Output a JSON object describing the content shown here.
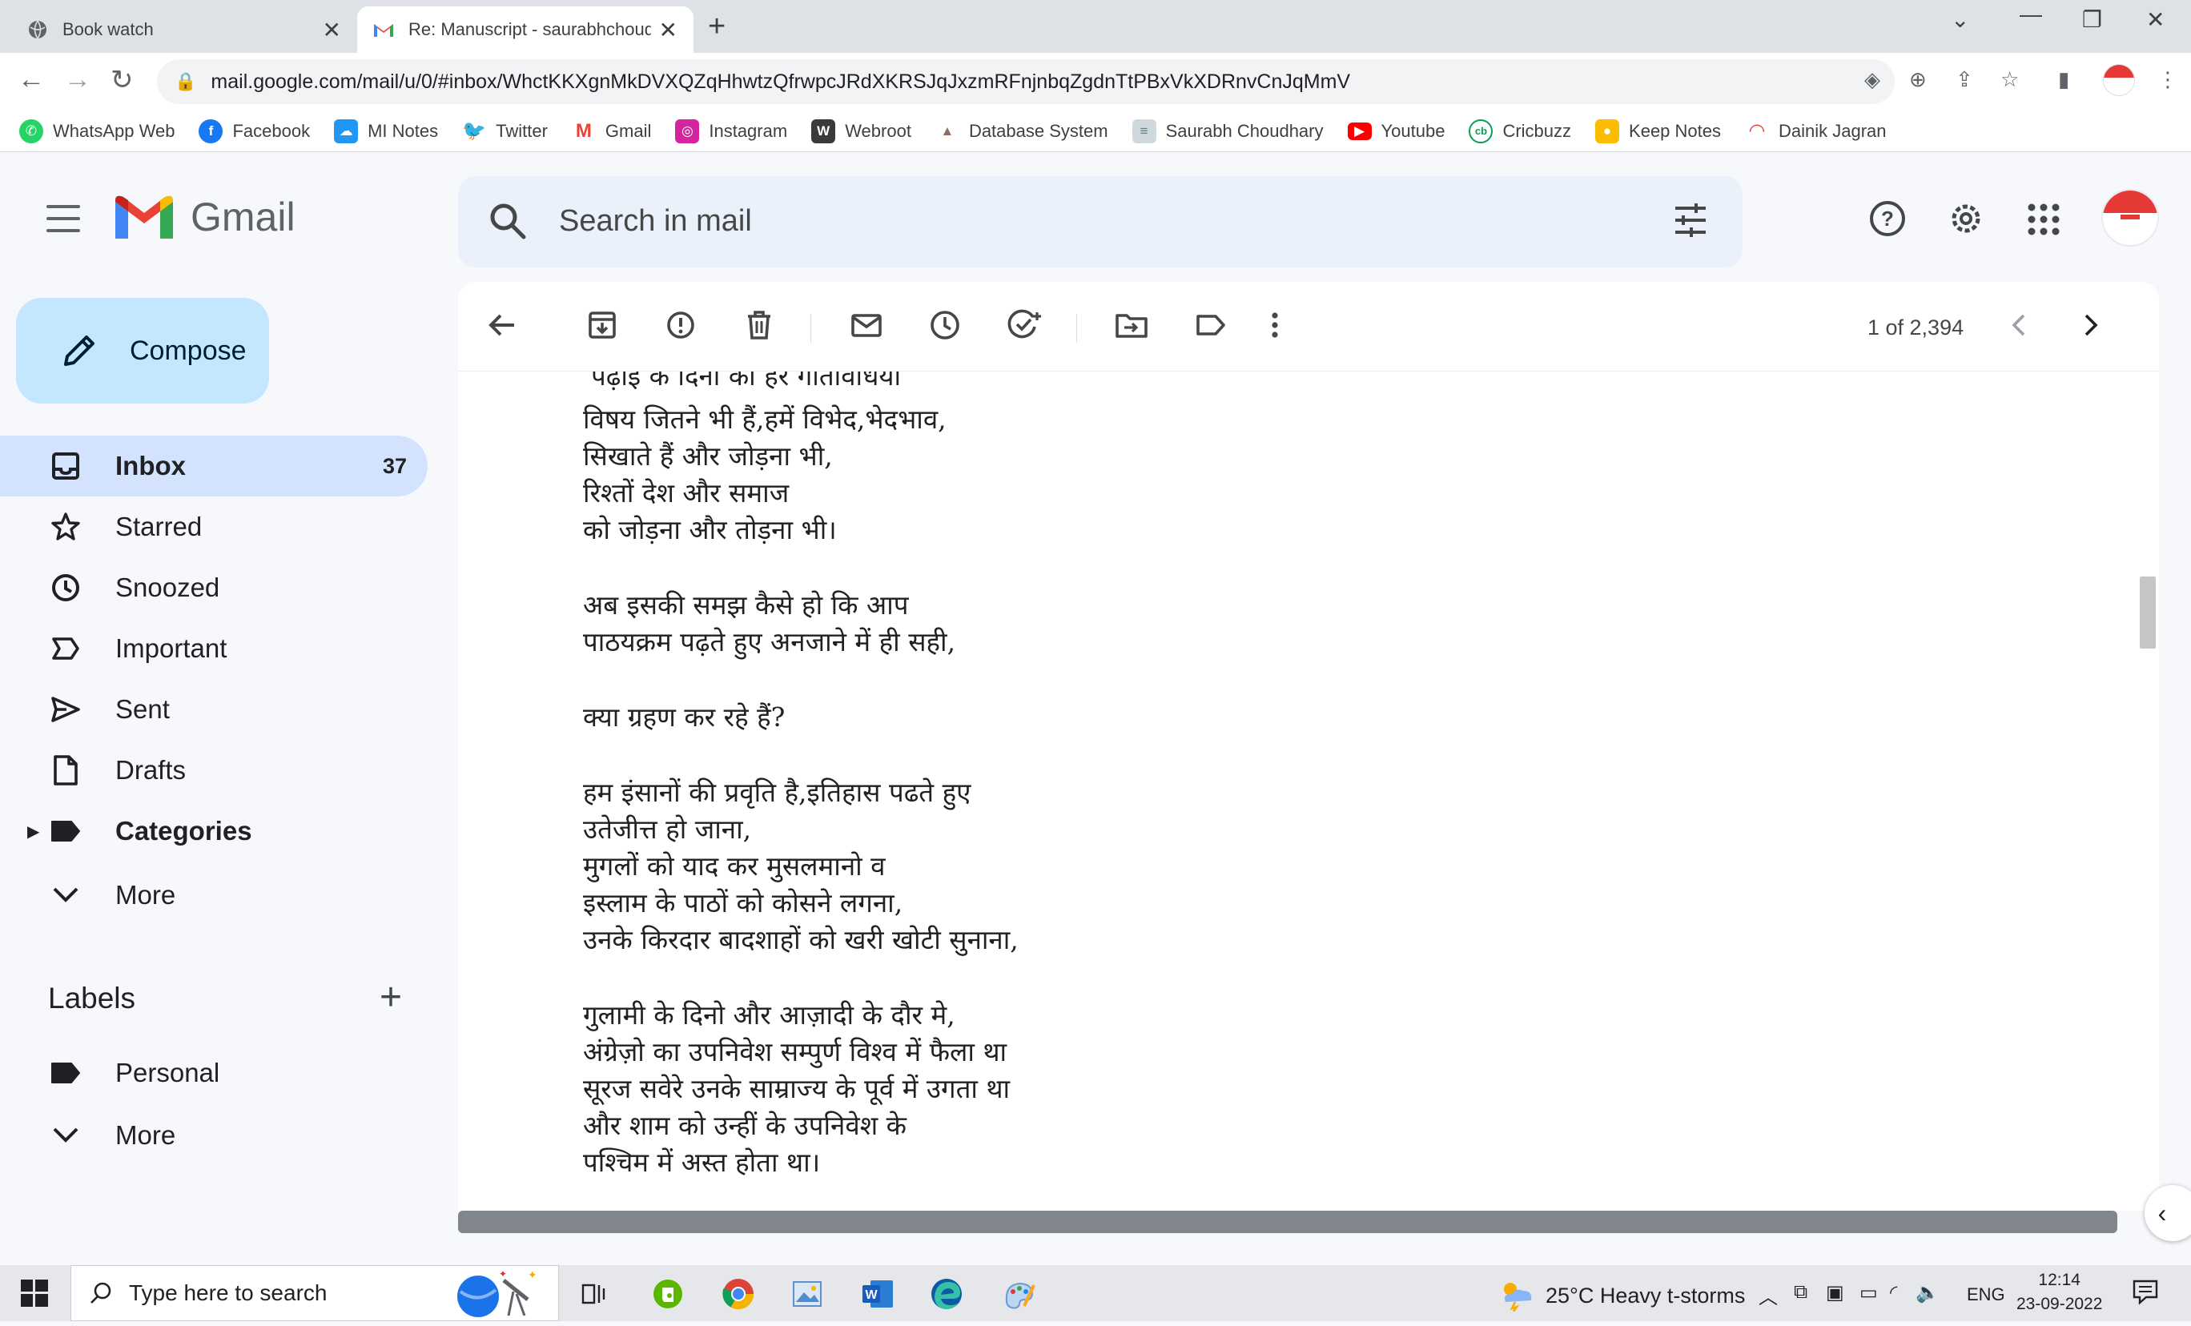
{
  "browser": {
    "tabs": [
      {
        "title": "Book watch",
        "icon": "globe-icon"
      },
      {
        "title": "Re: Manuscript - saurabhchoudh",
        "icon": "gmail-icon"
      }
    ],
    "url": "mail.google.com/mail/u/0/#inbox/WhctKKXgnMkDVXQZqHhwtzQfrwpcJRdXKRSJqJxzmRFnjnbqZgdnTtPBxVkXDRnvCnJqMmV",
    "bookmarks": [
      {
        "label": "WhatsApp Web",
        "icon": "whatsapp-icon",
        "color": "#25d366"
      },
      {
        "label": "Facebook",
        "icon": "facebook-icon",
        "color": "#1877f2"
      },
      {
        "label": "MI Notes",
        "icon": "cloud-icon",
        "color": "#2196f3"
      },
      {
        "label": "Twitter",
        "icon": "twitter-icon",
        "color": "#1da1f2"
      },
      {
        "label": "Gmail",
        "icon": "gmail-icon",
        "color": "#ea4335"
      },
      {
        "label": "Instagram",
        "icon": "instagram-icon",
        "color": "#d6249f"
      },
      {
        "label": "Webroot",
        "icon": "webroot-icon",
        "color": "#3a3a3a"
      },
      {
        "label": "Database System",
        "icon": "database-icon",
        "color": "#8d6e63"
      },
      {
        "label": "Saurabh Choudhary",
        "icon": "page-icon",
        "color": "#9e9e9e"
      },
      {
        "label": "Youtube",
        "icon": "youtube-icon",
        "color": "#ff0000"
      },
      {
        "label": "Cricbuzz",
        "icon": "cricbuzz-icon",
        "color": "#0b9d58"
      },
      {
        "label": "Keep Notes",
        "icon": "keep-icon",
        "color": "#fbbc04"
      },
      {
        "label": "Dainik Jagran",
        "icon": "jagran-icon",
        "color": "#e53935"
      }
    ]
  },
  "gmail": {
    "brand": "Gmail",
    "search_placeholder": "Search in mail",
    "compose": "Compose",
    "nav": [
      {
        "label": "Inbox",
        "icon": "inbox-icon",
        "count": "37",
        "active": true
      },
      {
        "label": "Starred",
        "icon": "star-icon"
      },
      {
        "label": "Snoozed",
        "icon": "clock-icon"
      },
      {
        "label": "Important",
        "icon": "important-icon"
      },
      {
        "label": "Sent",
        "icon": "send-icon"
      },
      {
        "label": "Drafts",
        "icon": "draft-icon"
      },
      {
        "label": "Categories",
        "icon": "label-icon"
      },
      {
        "label": "More",
        "icon": "chevron-down-icon"
      }
    ],
    "labels_heading": "Labels",
    "labels": [
      {
        "label": "Personal",
        "icon": "label-icon"
      },
      {
        "label": "More",
        "icon": "chevron-down-icon"
      }
    ],
    "pagination": "1 of 2,394",
    "colors": {
      "accent": "#0b57d0",
      "compose_bg": "#c2e7ff",
      "active_bg": "#d3e3fd"
    }
  },
  "message": {
    "lines": [
      "पढ़ाई के दिनों की हर गतिविधियां",
      "",
      "विषय जितने भी हैं,हमें विभेद,भेदभाव,",
      "सिखाते हैं और जोड़ना भी,",
      "रिश्तों देश और समाज",
      "को जोड़ना और तोड़ना भी।",
      "",
      "अब इसकी समझ कैसे हो कि आप",
      "पाठयक्रम पढ़ते हुए अनजाने में ही सही,",
      "",
      "क्या ग्रहण कर रहे हैं?",
      "",
      "हम इंसानों की प्रवृति है,इतिहास पढते हुए",
      "उतेजीत्त हो जाना,",
      "मुगलों को याद कर मुसलमानो व",
      "इस्लाम के पाठों को कोसने लगना,",
      "उनके किरदार बादशाहों को खरी खोटी सुनाना,",
      "",
      "गुलामी के दिनो और आज़ादी के दौर मे,",
      "अंग्रेज़ो का उपनिवेश सम्पुर्ण  विश्व में फैला था",
      "सूरज सवेरे उनके साम्राज्य के पूर्व में उगता था",
      "और शाम को उन्हीं के उपनिवेश के",
      "पश्चिम में अस्त होता था।"
    ]
  },
  "taskbar": {
    "search_placeholder": "Type here to search",
    "weather": "25°C  Heavy t-storms",
    "language": "ENG",
    "time": "12:14",
    "date": "23-09-2022"
  }
}
